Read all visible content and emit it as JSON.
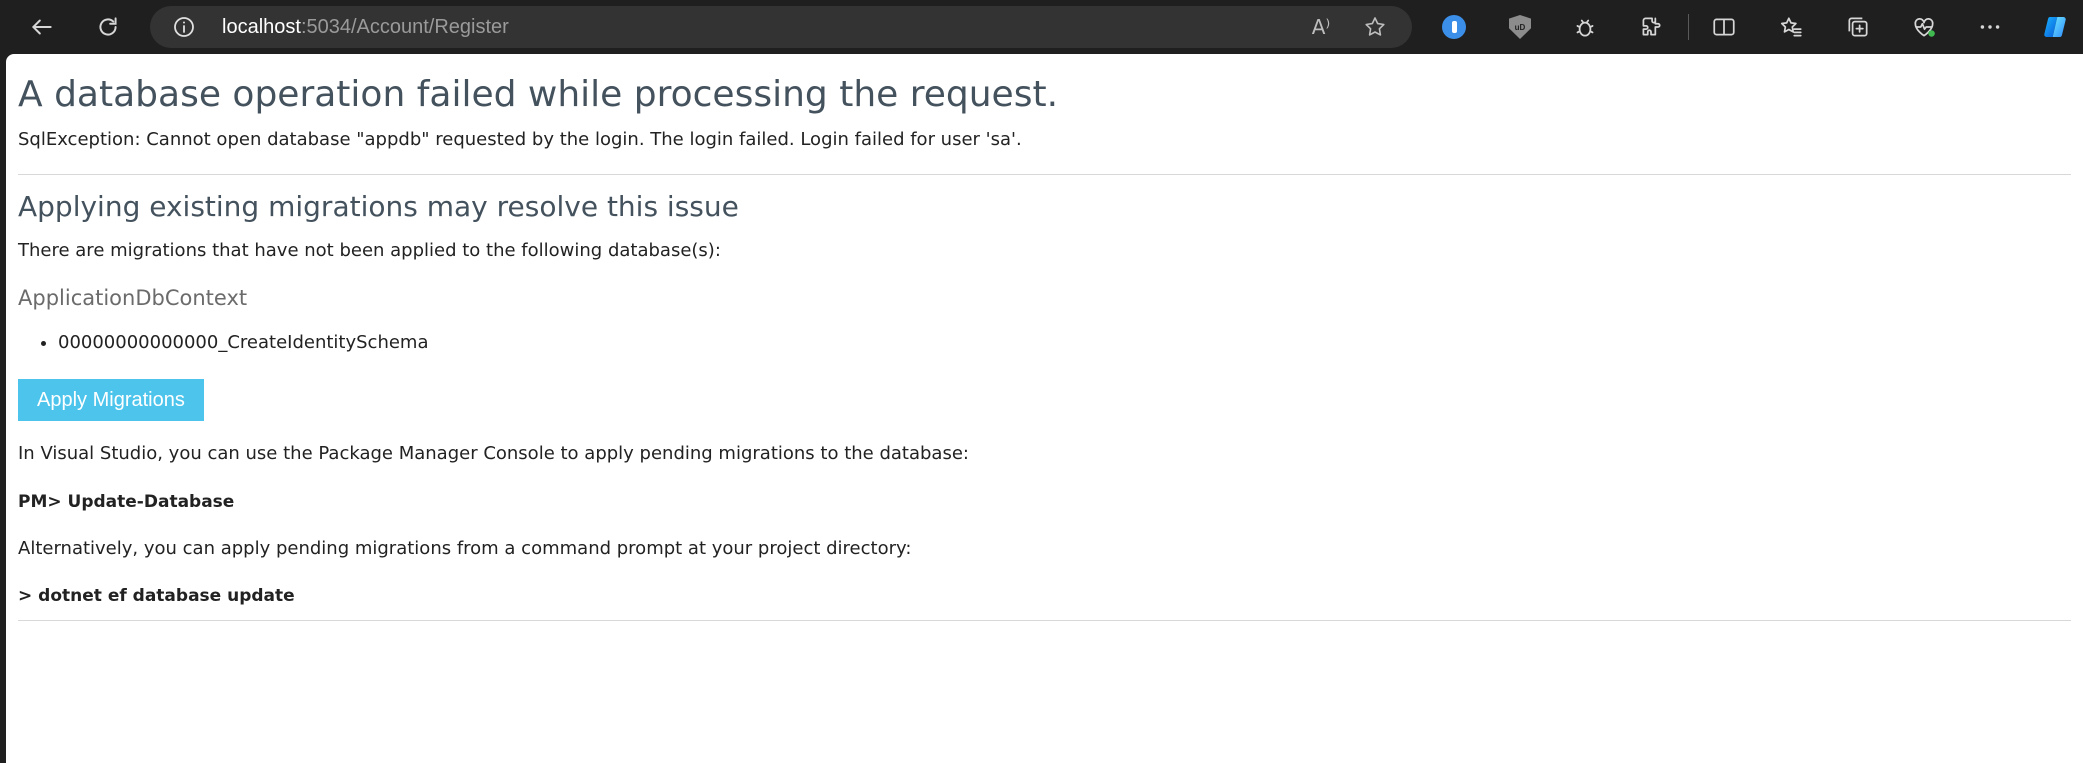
{
  "browser": {
    "address": {
      "host": "localhost",
      "rest": ":5034/Account/Register"
    },
    "read_aloud_glyph": "A⁾"
  },
  "page": {
    "title": "A database operation failed while processing the request.",
    "exception": "SqlException: Cannot open database \"appdb\" requested by the login. The login failed. Login failed for user 'sa'.",
    "migrations_heading": "Applying existing migrations may resolve this issue",
    "migrations_desc": "There are migrations that have not been applied to the following database(s):",
    "context_name": "ApplicationDbContext",
    "migrations": [
      "00000000000000_CreateIdentitySchema"
    ],
    "apply_button": "Apply Migrations",
    "vs_text": "In Visual Studio, you can use the Package Manager Console to apply pending migrations to the database:",
    "pm_command": "PM> Update-Database",
    "alt_text": "Alternatively, you can apply pending migrations from a command prompt at your project directory:",
    "cli_command": "> dotnet ef database update"
  },
  "colors": {
    "button": "#4cc4ec",
    "heading": "#44525e",
    "toolbar": "#1f1f1f"
  }
}
